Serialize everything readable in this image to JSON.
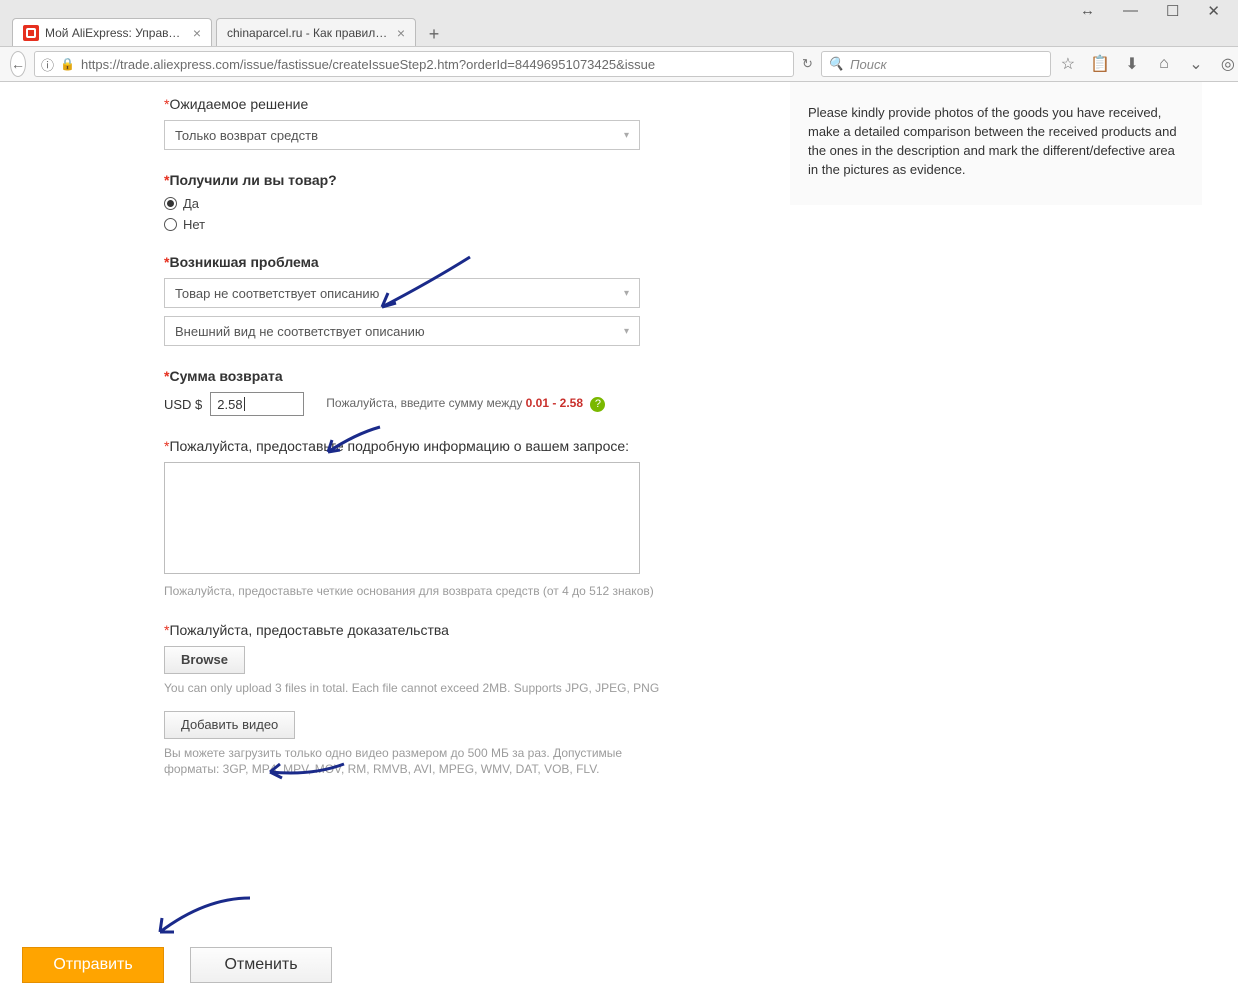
{
  "window": {
    "tabs": [
      {
        "title": "Мой AliExpress: Управлять",
        "active": true
      },
      {
        "title": "chinaparcel.ru - Как правильно",
        "active": false
      }
    ]
  },
  "toolbar": {
    "url": "https://trade.aliexpress.com/issue/fastissue/createIssueStep2.htm?orderId=84496951073425&issue",
    "search_placeholder": "Поиск"
  },
  "side": {
    "text": "Please kindly provide photos of the goods you have received, make a detailed comparison between the received products and the ones in the description and mark the different/defective area in the pictures as evidence."
  },
  "form": {
    "solution": {
      "label": "Ожидаемое решение",
      "value": "Только возврат средств"
    },
    "received": {
      "label": "Получили ли вы товар?",
      "yes": "Да",
      "no": "Нет"
    },
    "problem": {
      "label": "Возникшая проблема",
      "value1": "Товар не соответствует описанию",
      "value2": "Внешний вид не соответствует описанию"
    },
    "refund": {
      "label": "Сумма возврата",
      "currency": "USD $",
      "value": "2.58",
      "hint_prefix": "Пожалуйста, введите сумму между ",
      "range": "0.01 - 2.58"
    },
    "details": {
      "label": "Пожалуйста, предоставьте подробную информацию о вашем запросе:",
      "hint": "Пожалуйста, предоставьте четкие основания для возврата средств (от 4 до 512 знаков)"
    },
    "evidence": {
      "label": "Пожалуйста, предоставьте доказательства",
      "browse": "Browse",
      "upload_hint": "You can only upload 3 files in total. Each file cannot exceed 2MB. Supports JPG, JPEG, PNG",
      "add_video": "Добавить видео",
      "video_hint": "Вы можете загрузить только одно видео размером до 500 МБ за раз. Допустимые форматы: 3GP, MP4, MPV, MOV, RM, RMVB, AVI, MPEG, WMV, DAT, VOB, FLV."
    },
    "submit": "Отправить",
    "cancel": "Отменить"
  }
}
